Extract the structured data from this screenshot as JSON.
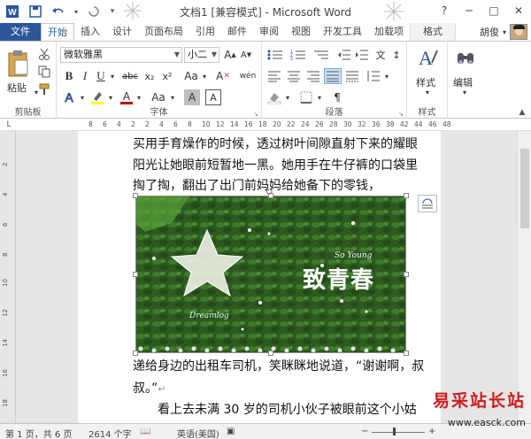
{
  "window": {
    "title": "文档1 [兼容模式] - Microsoft Word",
    "controls": [
      "?",
      "─",
      "□",
      "✕"
    ]
  },
  "quick_access": {
    "save_icon": "save-icon",
    "undo_icon": "undo-icon",
    "redo_icon": "redo-icon"
  },
  "tabs": {
    "file": "文件",
    "items": [
      "开始",
      "插入",
      "设计",
      "页面布局",
      "引用",
      "邮件",
      "审阅",
      "视图",
      "开发工具",
      "加载项"
    ],
    "contextual": "格式",
    "user": "胡俊"
  },
  "ribbon": {
    "clipboard": {
      "paste_label": "粘贴",
      "group_label": "剪贴板"
    },
    "font": {
      "font_name": "微软雅黑",
      "font_size": "小二",
      "group_label": "字体",
      "bold": "B",
      "italic": "I",
      "underline": "U",
      "strike": "abc",
      "subscript": "x₂",
      "superscript": "x²",
      "grow": "A",
      "shrink": "A",
      "case": "Aa",
      "clear": "A",
      "phonetic": "wén",
      "border": "A",
      "color_a": "A",
      "highlight_a": "A",
      "char_shade": "A"
    },
    "paragraph": {
      "group_label": "段落"
    },
    "styles": {
      "label": "样式",
      "group_label": "样式"
    },
    "editing": {
      "label": "编辑"
    }
  },
  "ruler": {
    "marks": [
      "8",
      "6",
      "4",
      "2",
      "2",
      "4",
      "6",
      "8",
      "10",
      "12",
      "14",
      "16",
      "18",
      "20",
      "22",
      "24",
      "26",
      "28",
      "30",
      "32",
      "36",
      "38",
      "42",
      "44",
      "46",
      "48"
    ],
    "vmarks": [
      "2",
      "4",
      "6",
      "8",
      "10",
      "12",
      "14",
      "16",
      "18"
    ]
  },
  "document": {
    "line1": "买用手育燥作的时候，透过树叶间隙直射下来的耀眼",
    "line2": "阳光让她眼前短暂地一黑。她用手在牛仔裤的口袋里",
    "line3": "掏了掏，翻出了出门前妈妈给她备下的零钱，",
    "line4": "递给身边的出租车司机，笑眯眯地说道，“谢谢啊，叔",
    "line5": "叔。”",
    "line6": "看上去未满 30 岁的司机小伙子被眼前这个小姑",
    "picture": {
      "text_main": "致青春",
      "text_en": "So Young",
      "text_script": "Dreamlog"
    }
  },
  "status": {
    "page": "第 1 页，共 6 页",
    "words": "2614 个字",
    "lang": "英语(美国)"
  },
  "watermark": {
    "title": "易采站长站",
    "url": "www.easck.com"
  },
  "colors": {
    "word_blue": "#2b579a",
    "font_red": "#c00000",
    "highlight_yellow": "#ffff00",
    "leaf_green": "#2c5b1e"
  }
}
